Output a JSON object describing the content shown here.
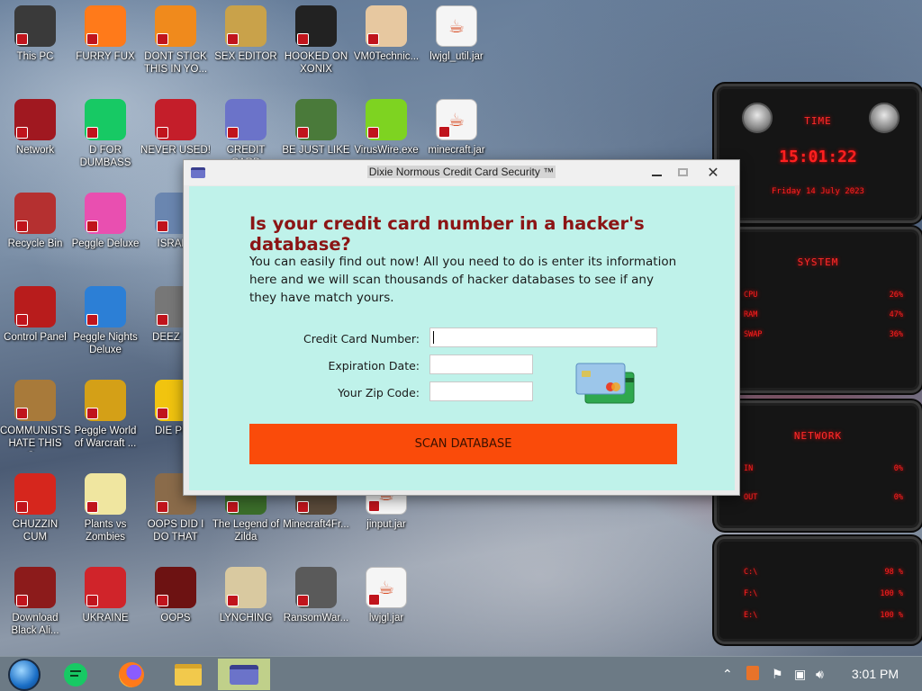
{
  "desktop": {
    "icons": [
      {
        "label": "This PC",
        "icon": "computer-icon"
      },
      {
        "label": "FURRY FUX",
        "icon": "firefox-icon"
      },
      {
        "label": "DONT STICK THIS IN YO...",
        "icon": "vlc-cone-icon"
      },
      {
        "label": "SEX EDITOR",
        "icon": "hxd-editor-icon"
      },
      {
        "label": "HOOKED ON XONIX",
        "icon": "xonix-game-icon"
      },
      {
        "label": "VM0Technic...",
        "icon": "doctor-icon"
      },
      {
        "label": "lwjgl_util.jar",
        "icon": "java-icon"
      },
      {
        "label": "Network",
        "icon": "network-icon"
      },
      {
        "label": "D FOR DUMBASS",
        "icon": "green-chat-icon"
      },
      {
        "label": "NEVER USED!",
        "icon": "devcpp-icon"
      },
      {
        "label": "CREDIT CARD",
        "icon": "credit-card-icon"
      },
      {
        "label": "BE JUST LIKE",
        "icon": "elf-icon"
      },
      {
        "label": "VirusWire.exe",
        "icon": "lime-icon"
      },
      {
        "label": "minecraft.jar",
        "icon": "java-icon"
      },
      {
        "label": "Recycle Bin",
        "icon": "recycle-bin-icon"
      },
      {
        "label": "Peggle Deluxe",
        "icon": "peggle-icon"
      },
      {
        "label": "ISRAEL",
        "icon": "network-share-icon"
      },
      {
        "label": "Control Panel",
        "icon": "control-panel-icon"
      },
      {
        "label": "Peggle Nights Deluxe",
        "icon": "peggle-nights-icon"
      },
      {
        "label": "DEEZ N...",
        "icon": "folder-stack-icon"
      },
      {
        "label": "COMMUNISTS HATE THIS G...",
        "icon": "money-bag-icon"
      },
      {
        "label": "Peggle World of Warcraft ...",
        "icon": "peggle-wow-icon"
      },
      {
        "label": "DIE PL...",
        "icon": "yellow-d-icon"
      },
      {
        "label": "CHUZZIN CUM",
        "icon": "chuzzle-icon"
      },
      {
        "label": "Plants vs Zombies",
        "icon": "flower-icon"
      },
      {
        "label": "OOPS DID I DO THAT",
        "icon": "portrait-icon"
      },
      {
        "label": "The Legend of Zilda",
        "icon": "zelda-icon"
      },
      {
        "label": "Minecraft4Fr...",
        "icon": "minecraft-icon"
      },
      {
        "label": "jinput.jar",
        "icon": "java-icon"
      },
      {
        "label": "Download Black Ali...",
        "icon": "alien-icon"
      },
      {
        "label": "UKRAINE",
        "icon": "radiation-icon"
      },
      {
        "label": "OOPS",
        "icon": "red-book-icon"
      },
      {
        "label": "LYNCHING",
        "icon": "noose-icon"
      },
      {
        "label": "RansomWar...",
        "icon": "skull-icon"
      },
      {
        "label": "lwjgl.jar",
        "icon": "java-icon"
      }
    ]
  },
  "window": {
    "title": "Dixie Normous Credit Card Security ™",
    "heading": "Is your credit card number in a hacker's database?",
    "intro": "You can easily find out now! All you need to do is enter its information here and we will scan thousands of hacker databases to see if any they have match yours.",
    "fields": {
      "card_label": "Credit Card Number:",
      "card_value": "",
      "exp_label": "Expiration Date:",
      "exp_value": "",
      "zip_label": "Your Zip Code:",
      "zip_value": ""
    },
    "button": "SCAN DATABASE",
    "colors": {
      "background": "#bff2ea",
      "heading": "#8b1515",
      "button": "#fa4b0a"
    }
  },
  "widgets": {
    "time": {
      "title": "TIME",
      "clock": "15:01:22",
      "date": "Friday 14 July 2023"
    },
    "system": {
      "title": "SYSTEM",
      "rows": [
        {
          "label": "CPU",
          "value": "26%"
        },
        {
          "label": "RAM",
          "value": "47%"
        },
        {
          "label": "SWAP",
          "value": "36%"
        }
      ]
    },
    "network": {
      "title": "NETWORK",
      "rows": [
        {
          "label": "IN",
          "value": "0%"
        },
        {
          "label": "OUT",
          "value": "0%"
        }
      ]
    },
    "drives": {
      "rows": [
        {
          "label": "C:\\",
          "value": "98 %"
        },
        {
          "label": "F:\\",
          "value": "100 %"
        },
        {
          "label": "E:\\",
          "value": "100 %"
        }
      ]
    }
  },
  "taskbar": {
    "clock": "3:01 PM",
    "items": [
      "start-orb-icon",
      "green-chat-icon",
      "firefox-icon",
      "file-explorer-icon",
      "credit-card-icon"
    ]
  }
}
